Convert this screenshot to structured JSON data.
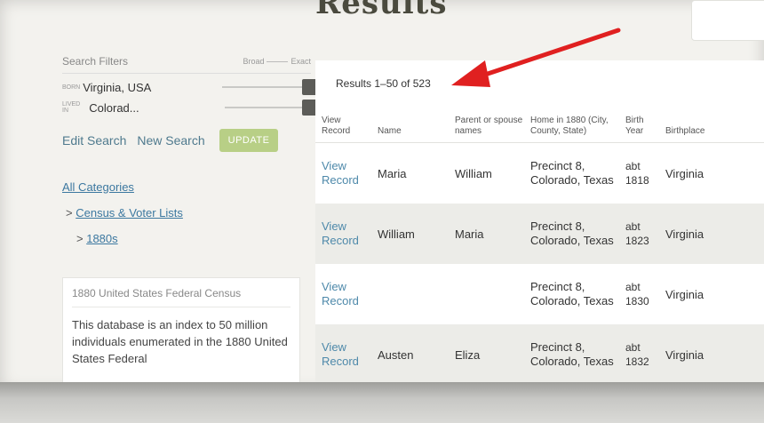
{
  "page": {
    "heading": "Results"
  },
  "sidebar": {
    "filters_title": "Search Filters",
    "broad_label": "Broad",
    "exact_label": "Exact",
    "filters": [
      {
        "label": "BORN",
        "value": "Virginia, USA"
      },
      {
        "label": "LIVED IN",
        "value": "Colorad..."
      }
    ],
    "edit_search": "Edit Search",
    "new_search": "New Search",
    "update": "UPDATE",
    "categories": {
      "all": "All Categories",
      "prefix": ">",
      "level1": "Census & Voter Lists",
      "level2": "1880s"
    },
    "database": {
      "title": "1880 United States Federal Census",
      "description": "This database is an index to 50 million individuals enumerated in the 1880 United States Federal"
    }
  },
  "results": {
    "count": "Results 1–50 of 523",
    "columns": [
      "View Record",
      "Name",
      "Parent or spouse names",
      "Home in 1880 (City, County, State)",
      "Birth Year",
      "Birthplace"
    ],
    "rows": [
      {
        "view": "View Record",
        "name": "Maria",
        "parent": "William",
        "home": "Precinct 8, Colorado, Texas",
        "year": "abt 1818",
        "birthplace": "Virginia"
      },
      {
        "view": "View Record",
        "name": "William",
        "parent": "Maria",
        "home": "Precinct 8, Colorado, Texas",
        "year": "abt 1823",
        "birthplace": "Virginia"
      },
      {
        "view": "View Record",
        "name": "",
        "parent": "",
        "home": "Precinct 8, Colorado, Texas",
        "year": "abt 1830",
        "birthplace": "Virginia"
      },
      {
        "view": "View Record",
        "name": "Austen",
        "parent": "Eliza",
        "home": "Precinct 8, Colorado, Texas",
        "year": "abt 1832",
        "birthplace": "Virginia"
      }
    ]
  },
  "annotation": {
    "arrow_color": "#e02020",
    "arrow_icon": "red-arrow-icon"
  }
}
